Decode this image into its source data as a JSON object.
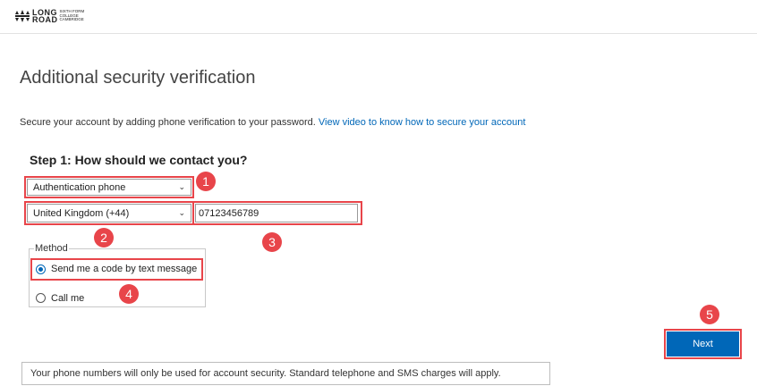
{
  "header": {
    "logo_main": "LONG\nROAD",
    "logo_sub": "SIXTH FORM COLLEGE CAMBRIDGE"
  },
  "page": {
    "title": "Additional security verification",
    "intro_text": "Secure your account by adding phone verification to your password. ",
    "intro_link": "View video to know how to secure your account",
    "step_heading": "Step 1: How should we contact you?"
  },
  "form": {
    "contact_method_selected": "Authentication phone",
    "country_selected": "United Kingdom (+44)",
    "phone_value": "07123456789",
    "method_legend": "Method",
    "method_options": [
      {
        "label": "Send me a code by text message",
        "selected": true
      },
      {
        "label": "Call me",
        "selected": false
      }
    ],
    "next_label": "Next"
  },
  "callouts": [
    "1",
    "2",
    "3",
    "4",
    "5"
  ],
  "footer": {
    "note": "Your phone numbers will only be used for account security. Standard telephone and SMS charges will apply."
  },
  "colors": {
    "accent": "#0067b8",
    "highlight": "#e8454a"
  }
}
